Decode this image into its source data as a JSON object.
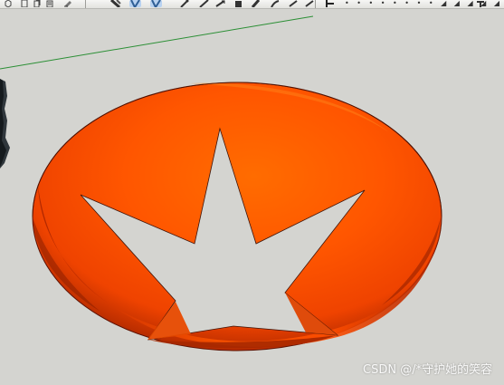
{
  "toolbar": {
    "tools": [
      {
        "name": "cube-tool",
        "icon": "cube-icon"
      },
      {
        "name": "page-tool",
        "icon": "page-icon"
      },
      {
        "name": "copy-tool",
        "icon": "copy-icon"
      },
      {
        "name": "pencil-tool",
        "icon": "pencil-icon"
      },
      {
        "name": "select-tool",
        "icon": "select-icon",
        "active": true
      },
      {
        "name": "orbit-tool",
        "icon": "orbit-icon",
        "active": true
      },
      {
        "name": "pan-tool",
        "icon": "pan-icon"
      },
      {
        "name": "shape-tool",
        "icon": "shape-icon"
      },
      {
        "name": "move-tool",
        "icon": "move-icon"
      },
      {
        "name": "rotate-tool",
        "icon": "rotate-icon"
      },
      {
        "name": "scale-tool",
        "icon": "scale-icon"
      },
      {
        "name": "push-tool",
        "icon": "push-icon"
      },
      {
        "name": "follow-tool",
        "icon": "follow-icon"
      },
      {
        "name": "offset-tool",
        "icon": "offset-icon"
      },
      {
        "name": "tape-tool",
        "icon": "tape-icon"
      },
      {
        "name": "dimension-tool",
        "icon": "dimension-icon"
      },
      {
        "name": "text-tool",
        "icon": "text-icon"
      }
    ],
    "colors": {
      "background": "#e8e8e4",
      "active": "#b8d2f1",
      "icon": "#444444"
    }
  },
  "viewport": {
    "model": {
      "name": "red-hemisphere-bowl-with-star-cutout",
      "main_color": "#ff5a00",
      "shadow_color": "#c13300",
      "cutout_color": "#d4d4d0",
      "axis_color": "#2b8f35"
    }
  },
  "watermark": {
    "text": "CSDN @/*守护她的笑容"
  }
}
